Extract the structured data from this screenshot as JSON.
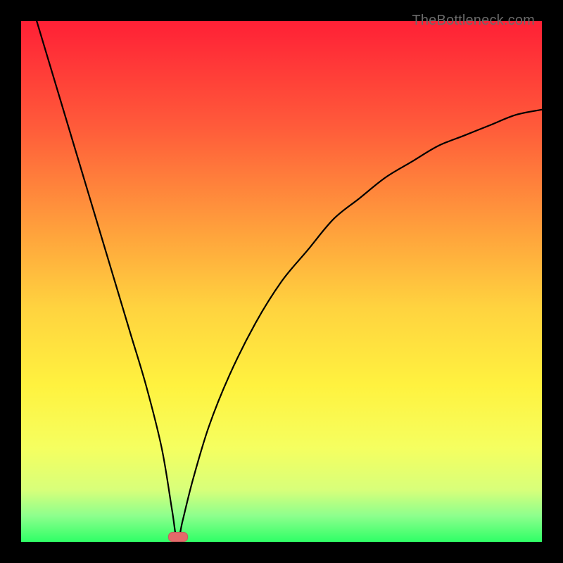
{
  "watermark": "TheBottleneck.com",
  "chart_data": {
    "type": "line",
    "title": "",
    "xlabel": "",
    "ylabel": "",
    "xlim": [
      0,
      100
    ],
    "ylim": [
      0,
      100
    ],
    "grid": false,
    "legend": false,
    "series": [
      {
        "name": "bottleneck-curve",
        "color": "#000000",
        "x": [
          3,
          6,
          9,
          12,
          15,
          18,
          21,
          24,
          27,
          29,
          30,
          31,
          33,
          36,
          40,
          45,
          50,
          55,
          60,
          65,
          70,
          75,
          80,
          85,
          90,
          95,
          100
        ],
        "y": [
          100,
          90,
          80,
          70,
          60,
          50,
          40,
          30,
          18,
          6,
          0,
          4,
          12,
          22,
          32,
          42,
          50,
          56,
          62,
          66,
          70,
          73,
          76,
          78,
          80,
          82,
          83
        ]
      }
    ],
    "annotations": [
      {
        "name": "optimum-marker",
        "x": 30,
        "y": 0,
        "color": "#e46a6a"
      }
    ],
    "background": {
      "type": "vertical-gradient",
      "stops": [
        {
          "pos": 0.0,
          "color": "#ff2036"
        },
        {
          "pos": 0.2,
          "color": "#ff5a3a"
        },
        {
          "pos": 0.4,
          "color": "#ffa03c"
        },
        {
          "pos": 0.55,
          "color": "#ffd33f"
        },
        {
          "pos": 0.7,
          "color": "#fff23f"
        },
        {
          "pos": 0.82,
          "color": "#f5ff60"
        },
        {
          "pos": 0.9,
          "color": "#d8ff7a"
        },
        {
          "pos": 0.95,
          "color": "#8dff8d"
        },
        {
          "pos": 1.0,
          "color": "#2fff66"
        }
      ]
    }
  }
}
